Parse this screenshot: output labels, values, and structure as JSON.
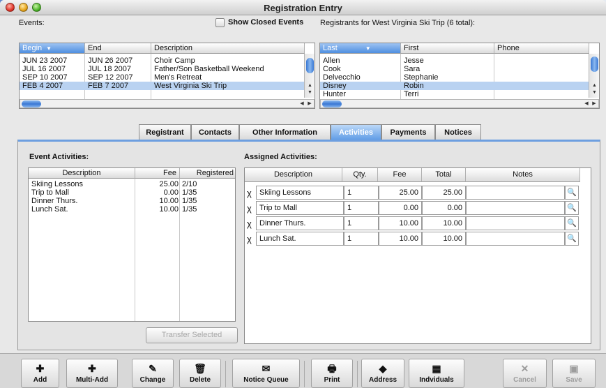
{
  "window": {
    "title": "Registration Entry"
  },
  "events": {
    "label": "Events:",
    "show_closed_label": "Show Closed Events",
    "columns": [
      "Begin",
      "End",
      "Description"
    ],
    "rows": [
      {
        "begin": "JUN 23 2007",
        "end": "JUN 26 2007",
        "description": "Choir Camp"
      },
      {
        "begin": "JUL 16 2007",
        "end": "JUL 18 2007",
        "description": "Father/Son Basketball Weekend"
      },
      {
        "begin": "SEP 10 2007",
        "end": "SEP 12 2007",
        "description": "Men's Retreat"
      },
      {
        "begin": "FEB 4 2007",
        "end": "FEB 7 2007",
        "description": "West Virginia Ski Trip"
      }
    ]
  },
  "registrants": {
    "label": "Registrants for West Virginia Ski Trip (6 total):",
    "columns": [
      "Last",
      "First",
      "Phone"
    ],
    "rows": [
      {
        "last": "Allen",
        "first": "Jesse"
      },
      {
        "last": "Cook",
        "first": "Sara"
      },
      {
        "last": "Delvecchio",
        "first": "Stephanie"
      },
      {
        "last": "Disney",
        "first": "Robin"
      },
      {
        "last": "Hunter",
        "first": "Terri"
      }
    ]
  },
  "tabs": [
    "Registrant",
    "Contacts",
    "Other Information",
    "Activities",
    "Payments",
    "Notices"
  ],
  "event_activities": {
    "label": "Event Activities:",
    "columns": [
      "Description",
      "Fee",
      "Registered"
    ],
    "rows": [
      {
        "description": "Skiing Lessons",
        "fee": "25.00",
        "registered": "2/10"
      },
      {
        "description": "Trip to Mall",
        "fee": "0.00",
        "registered": "1/35"
      },
      {
        "description": "Dinner Thurs.",
        "fee": "10.00",
        "registered": "1/35"
      },
      {
        "description": "Lunch Sat.",
        "fee": "10.00",
        "registered": "1/35"
      }
    ],
    "transfer_label": "Transfer Selected"
  },
  "assigned_activities": {
    "label": "Assigned Activities:",
    "columns": [
      "Description",
      "Qty.",
      "Fee",
      "Total",
      "Notes"
    ],
    "rows": [
      {
        "description": "Skiing Lessons",
        "qty": "1",
        "fee": "25.00",
        "total": "25.00",
        "notes": ""
      },
      {
        "description": "Trip to Mall",
        "qty": "1",
        "fee": "0.00",
        "total": "0.00",
        "notes": ""
      },
      {
        "description": "Dinner Thurs.",
        "qty": "1",
        "fee": "10.00",
        "total": "10.00",
        "notes": ""
      },
      {
        "description": "Lunch Sat.",
        "qty": "1",
        "fee": "10.00",
        "total": "10.00",
        "notes": ""
      }
    ]
  },
  "toolbar": {
    "add": "Add",
    "multi_add": "Multi-Add",
    "change": "Change",
    "delete": "Delete",
    "notice_queue": "Notice Queue",
    "print": "Print",
    "address": "Address",
    "individuals": "Indviduals",
    "cancel": "Cancel",
    "save": "Save"
  },
  "colors": {
    "accent": "#4f8fe0",
    "selection": "#b9d2f1"
  }
}
